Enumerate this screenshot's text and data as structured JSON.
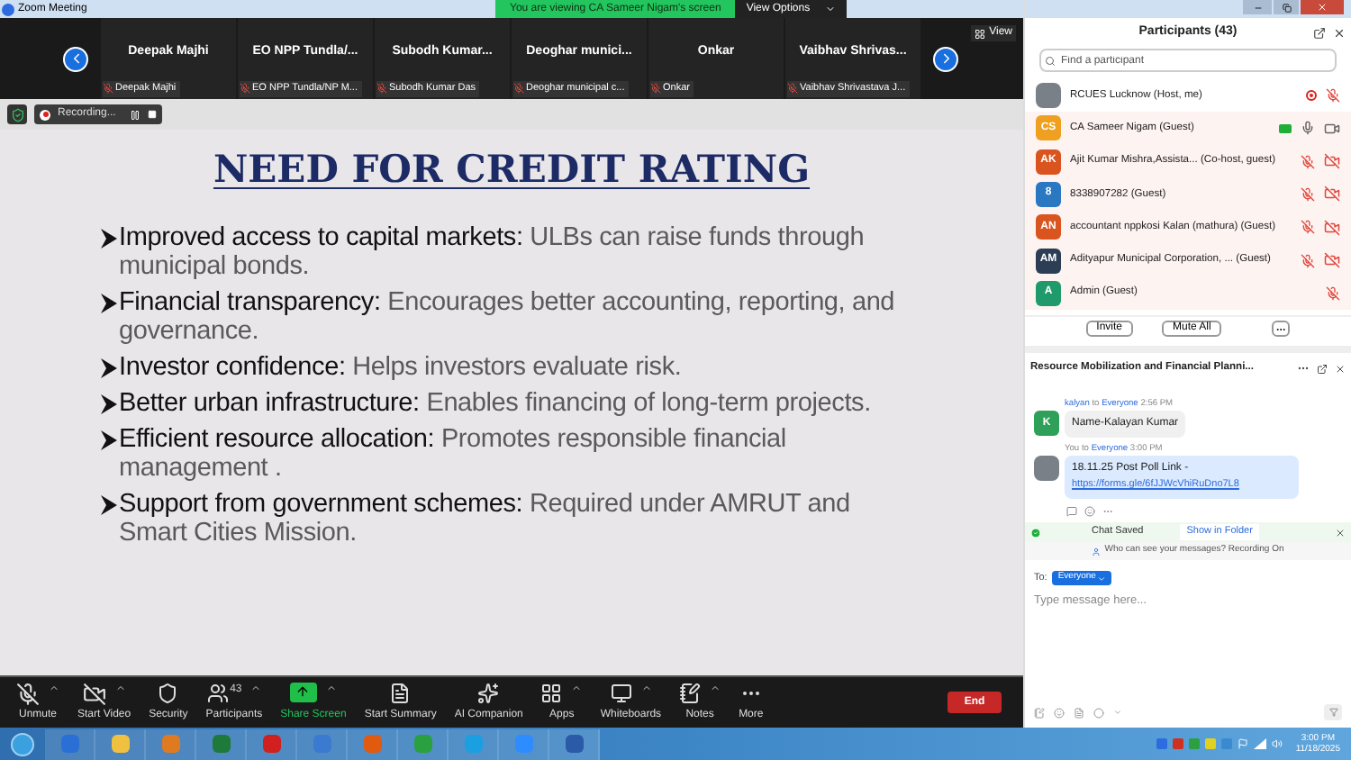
{
  "window": {
    "title": "Zoom Meeting"
  },
  "banner": {
    "text": "You are viewing CA Sameer Nigam's screen",
    "options": "View Options"
  },
  "gallery": {
    "view_label": "View",
    "tiles": [
      {
        "name": "Deepak Majhi",
        "label": "Deepak Majhi",
        "muted": true
      },
      {
        "name": "EO NPP Tundla/...",
        "label": "EO NPP Tundla/NP M...",
        "muted": true
      },
      {
        "name": "Subodh Kumar...",
        "label": "Subodh Kumar Das",
        "muted": true
      },
      {
        "name": "Deoghar munici...",
        "label": "Deoghar municipal c...",
        "muted": true
      },
      {
        "name": "Onkar",
        "label": "Onkar",
        "muted": true
      },
      {
        "name": "Vaibhav Shrivas...",
        "label": "Vaibhav Shrivastava J...",
        "muted": true
      }
    ]
  },
  "recording": {
    "label": "Recording..."
  },
  "slide": {
    "title": "NEED FOR CREDIT RATING",
    "bullets": [
      {
        "term": "Improved access to capital markets:",
        "text": "ULBs can raise funds through municipal bonds."
      },
      {
        "term": "Financial transparency:",
        "text": "Encourages better accounting, reporting, and governance."
      },
      {
        "term": "Investor confidence:",
        "text": "Helps investors evaluate risk."
      },
      {
        "term": "Better urban infrastructure:",
        "text": "Enables financing of long-term projects."
      },
      {
        "term": "Efficient resource allocation:",
        "text": "Promotes responsible financial management ."
      },
      {
        "term": "Support from government schemes:",
        "text": "Required under AMRUT and Smart Cities Mission."
      }
    ]
  },
  "toolbar": {
    "items": [
      {
        "kind": "mic",
        "label": "Unmute",
        "caret": true
      },
      {
        "kind": "video",
        "label": "Start Video",
        "caret": true
      },
      {
        "kind": "security",
        "label": "Security",
        "caret": false
      },
      {
        "kind": "participants",
        "label": "Participants",
        "count": "43",
        "caret": true
      },
      {
        "kind": "share",
        "label": "Share Screen",
        "caret": true
      },
      {
        "kind": "summary",
        "label": "Start Summary",
        "caret": false
      },
      {
        "kind": "ai",
        "label": "AI Companion",
        "caret": false
      },
      {
        "kind": "apps",
        "label": "Apps",
        "caret": true
      },
      {
        "kind": "whiteboards",
        "label": "Whiteboards",
        "caret": true
      },
      {
        "kind": "notes",
        "label": "Notes",
        "caret": true
      },
      {
        "kind": "more",
        "label": "More",
        "caret": false
      }
    ],
    "end": "End"
  },
  "participants": {
    "title": "Participants (43)",
    "search_placeholder": "Find a participant",
    "list": [
      {
        "kind": "photo",
        "name": "RCUES Lucknow (Host, me)",
        "selected": false,
        "recording": true,
        "sharing": false,
        "mic_muted": true
      },
      {
        "kind": "initials",
        "initials": "CS",
        "color": "#f0a020",
        "name": "CA Sameer Nigam (Guest)",
        "selected": true,
        "recording": false,
        "sharing": true,
        "mic_muted": false,
        "video_muted": false
      },
      {
        "kind": "initials",
        "initials": "AK",
        "color": "#d9541e",
        "name": "Ajit Kumar Mishra,Assista...  (Co-host, guest)",
        "selected": true,
        "recording": false,
        "sharing": false,
        "mic_muted": true,
        "video_muted": true
      },
      {
        "kind": "initials",
        "initials": "8",
        "color": "#2b78c2",
        "name": "8338907282 (Guest)",
        "selected": true,
        "recording": false,
        "sharing": false,
        "mic_muted": true,
        "video_muted": true
      },
      {
        "kind": "initials",
        "initials": "AN",
        "color": "#d9541e",
        "name": "accountant nppkosi Kalan (mathura) (Guest)",
        "selected": true,
        "recording": false,
        "sharing": false,
        "mic_muted": true,
        "video_muted": true
      },
      {
        "kind": "initials",
        "initials": "AM",
        "color": "#2c3e55",
        "name": "Adityapur Municipal Corporation, ...  (Guest)",
        "selected": true,
        "recording": false,
        "sharing": false,
        "mic_muted": true,
        "video_muted": true
      },
      {
        "kind": "initials",
        "initials": "A",
        "color": "#1f9a6a",
        "name": "Admin (Guest)",
        "selected": true,
        "recording": false,
        "sharing": false,
        "mic_muted": true
      }
    ],
    "buttons": [
      "Invite",
      "Mute All"
    ]
  },
  "chat": {
    "title": "Resource Mobilization and Financial Planni...",
    "messages": [
      {
        "kind": "initials",
        "initials": "K",
        "color": "#2fa05a",
        "sender": "kalyan",
        "to": "to",
        "audience": "Everyone",
        "time": "2:56 PM",
        "own": false,
        "text": "Name-Kalayan Kumar"
      },
      {
        "kind": "photo",
        "sender": "You",
        "to": "to",
        "audience": "Everyone",
        "time": "3:00 PM",
        "own": true,
        "text": "18.11.25 Post Poll Link -",
        "link": "https://forms.gle/6fJJWcVhiRuDno7L8"
      }
    ],
    "saved": {
      "text": "Chat Saved",
      "action": "Show in Folder"
    },
    "notice": "Who can see your messages? Recording On",
    "to_label": "To:",
    "recipient": "Everyone",
    "placeholder": "Type message here..."
  },
  "taskbar": {
    "time": "3:00 PM",
    "date": "11/18/2025"
  }
}
